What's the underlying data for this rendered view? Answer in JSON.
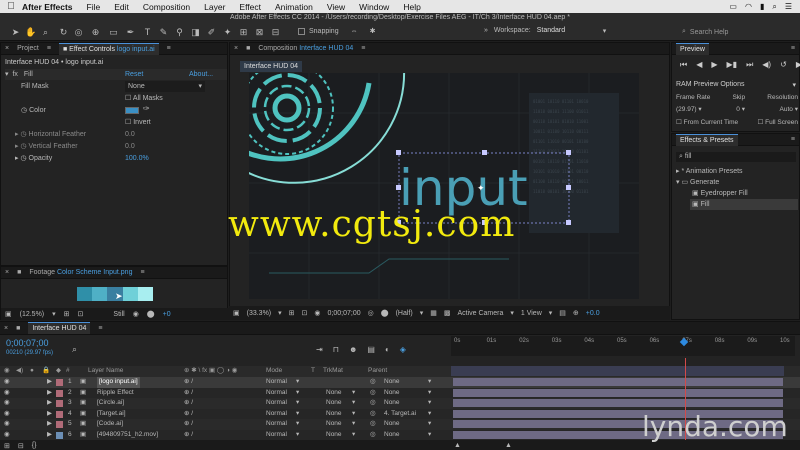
{
  "menubar": {
    "app_name": "After Effects",
    "items": [
      "File",
      "Edit",
      "Composition",
      "Layer",
      "Effect",
      "Animation",
      "View",
      "Window",
      "Help"
    ]
  },
  "window_title": "Adobe After Effects CC 2014 - /Users/recording/Desktop/Exercise Files AEG - IT/Ch 3/Interface HUD 04.aep *",
  "toolbar": {
    "snapping_label": "Snapping",
    "workspace_label": "Workspace:",
    "workspace_value": "Standard",
    "search_placeholder": "Search Help"
  },
  "project_panel": {
    "tab_project": "Project",
    "tab_effect_controls": "Effect Controls",
    "tab_effect_controls_target": "logo input.ai",
    "breadcrumb": "Interface HUD 04 • logo input.ai",
    "fx_name": "Fill",
    "reset": "Reset",
    "about": "About...",
    "fill_mask_label": "Fill Mask",
    "fill_mask_value": "None",
    "all_masks": "All Masks",
    "color_label": "Color",
    "invert": "Invert",
    "horizontal_feather_label": "Horizontal Feather",
    "horizontal_feather_value": "0.0",
    "vertical_feather_label": "Vertical Feather",
    "vertical_feather_value": "0.0",
    "opacity_label": "Opacity",
    "opacity_value": "100.0%"
  },
  "footage_panel": {
    "tab": "Footage",
    "file": "Color Scheme Input.png",
    "zoom": "(12.5%)",
    "mode": "Still"
  },
  "composition_panel": {
    "tab": "Composition",
    "tab_target": "Interface HUD 04",
    "comp_tab": "Interface HUD 04",
    "canvas_text": "input",
    "zoom": "(33.3%)",
    "timecode": "0;00;07;00",
    "resolution": "(Half)",
    "camera": "Active Camera",
    "view": "1 View",
    "offset": "+0.0"
  },
  "preview_panel": {
    "tab": "Preview",
    "ram_preview": "RAM Preview Options",
    "frame_rate_label": "Frame Rate",
    "skip_label": "Skip",
    "resolution_label": "Resolution",
    "frame_rate_value": "(29.97)",
    "skip_value": "0",
    "resolution_value": "Auto",
    "from_current": "From Current Time",
    "full_screen": "Full Screen"
  },
  "effects_panel": {
    "tab": "Effects & Presets",
    "search_value": "fill",
    "animation_presets": "* Animation Presets",
    "generate": "Generate",
    "eyedropper_fill": "Eyedropper Fill",
    "fill": "Fill"
  },
  "timeline": {
    "tab": "Interface HUD 04",
    "timecode": "0;00;07;00",
    "frame_info": "00210 (29.97 fps)",
    "header_layer_name": "Layer Name",
    "header_mode": "Mode",
    "header_t": "T",
    "header_trkmat": "TrkMat",
    "header_parent": "Parent",
    "ruler": [
      "0s",
      "01s",
      "02s",
      "03s",
      "04s",
      "05s",
      "06s",
      "07s",
      "08s",
      "09s",
      "10s"
    ],
    "layers": [
      {
        "num": "1",
        "name": "[logo input.ai]",
        "mode": "Normal",
        "trkmat": "",
        "parent": "None",
        "color": "#b06b78"
      },
      {
        "num": "2",
        "name": "Ripple Effect",
        "mode": "Normal",
        "trkmat": "None",
        "parent": "None",
        "color": "#b06b78"
      },
      {
        "num": "3",
        "name": "[Circle.ai]",
        "mode": "Normal",
        "trkmat": "None",
        "parent": "None",
        "color": "#b06b78"
      },
      {
        "num": "4",
        "name": "[Target.ai]",
        "mode": "Normal",
        "trkmat": "None",
        "parent": "4. Target.ai",
        "color": "#b06b78"
      },
      {
        "num": "5",
        "name": "[Code.ai]",
        "mode": "Normal",
        "trkmat": "None",
        "parent": "None",
        "color": "#b06b78"
      },
      {
        "num": "6",
        "name": "[494809751_h2.mov]",
        "mode": "Normal",
        "trkmat": "None",
        "parent": "None",
        "color": "#6c8fb5"
      }
    ]
  },
  "watermark": "www.cgtsj.com",
  "brand_watermark": "lynda.com",
  "colors": {
    "accent_blue": "#4a9fe0",
    "teal": "#4fc3c0",
    "watermark_yellow": "#f2ea0e",
    "layer_bar": "#6e6a84",
    "playhead": "#2d8ae0"
  }
}
